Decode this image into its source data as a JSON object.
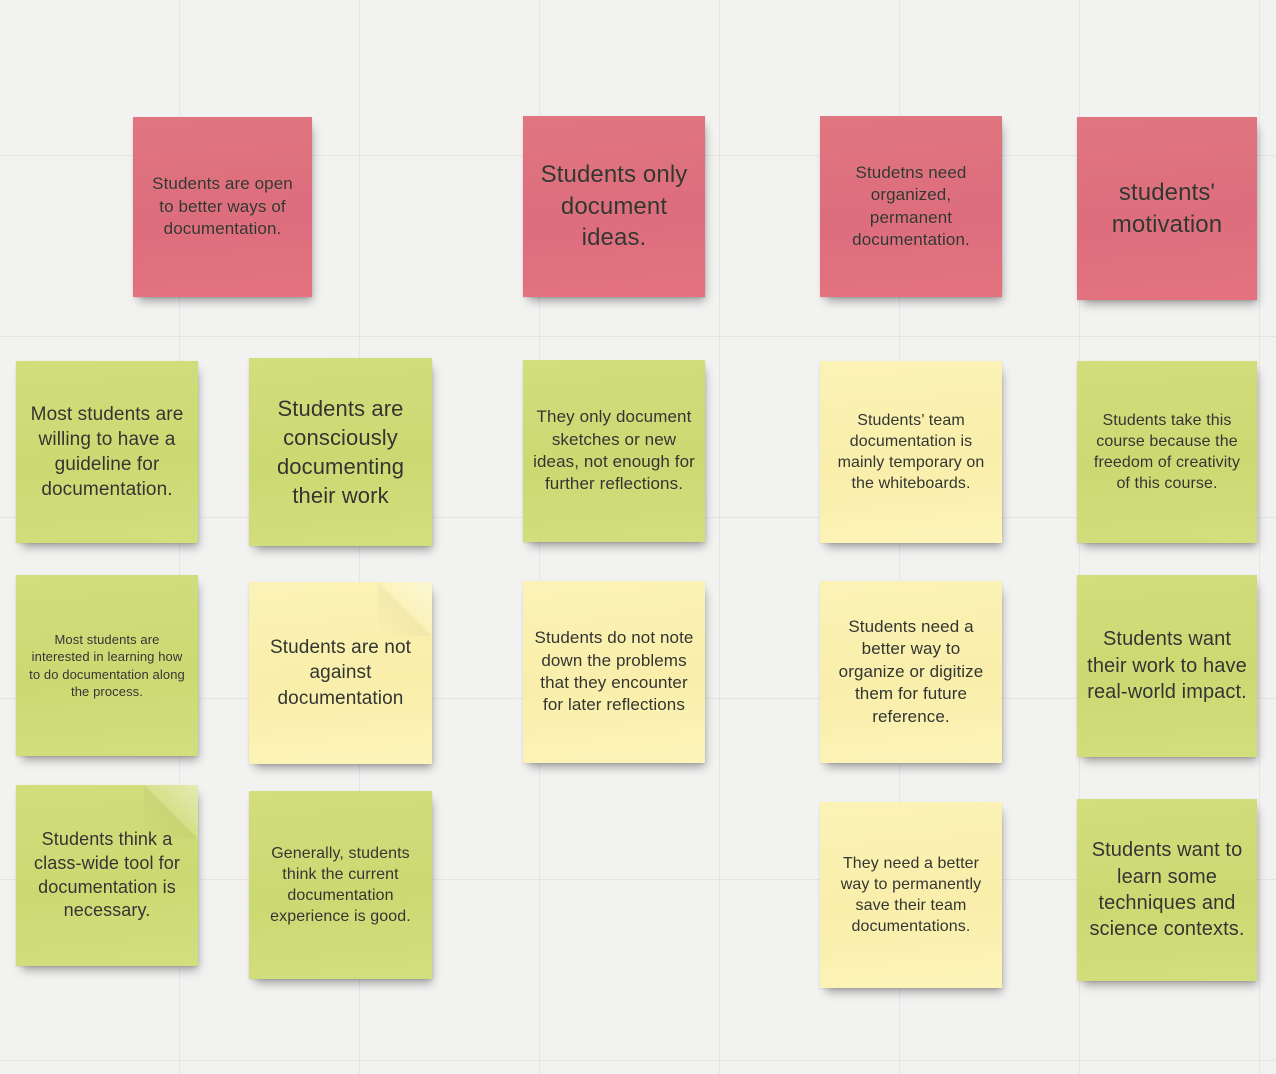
{
  "board": {
    "name": "sticky-note-board",
    "background_color": "#f2f2f1",
    "grid_color": "#e6e6e5",
    "grid_size_px": 180
  },
  "colors": {
    "pink": "#de707e",
    "green": "#cedb76",
    "yellow": "#faf0ae",
    "text": "#33352f"
  },
  "notes": [
    {
      "id": "note-r1c1",
      "color": "pink",
      "font_px": 17,
      "text": "Students are open to better ways of documentation."
    },
    {
      "id": "note-r1c3",
      "color": "pink",
      "font_px": 24,
      "text": "Students only document ideas."
    },
    {
      "id": "note-r1c4",
      "color": "pink",
      "font_px": 17,
      "text": "Studetns need organized, permanent documentation."
    },
    {
      "id": "note-r1c5",
      "color": "pink",
      "font_px": 24,
      "text": "students' motivation"
    },
    {
      "id": "note-r2c1",
      "color": "green",
      "font_px": 19,
      "text": "Most students are willing to have a guideline for documentation."
    },
    {
      "id": "note-r2c2",
      "color": "green",
      "font_px": 22,
      "text": "Students are consciously documenting their work"
    },
    {
      "id": "note-r2c3",
      "color": "green",
      "font_px": 17,
      "text": "They only document sketches or new ideas, not enough for further reflections."
    },
    {
      "id": "note-r2c4",
      "color": "yellow",
      "font_px": 16,
      "text": "Students’ team documentation is mainly temporary on the whiteboards."
    },
    {
      "id": "note-r2c5",
      "color": "green",
      "font_px": 16,
      "text": "Students take this course because the freedom of creativity of this course."
    },
    {
      "id": "note-r3c1",
      "color": "green",
      "font_px": 13,
      "text": "Most students are interested in learning how to do documentation along the  process."
    },
    {
      "id": "note-r3c2",
      "color": "yellow",
      "font_px": 19,
      "creased": true,
      "text": "Students are not against documentation"
    },
    {
      "id": "note-r3c3",
      "color": "yellow",
      "font_px": 17,
      "text": "Students do not note down the problems that they encounter for later reflections"
    },
    {
      "id": "note-r3c4",
      "color": "yellow",
      "font_px": 17,
      "text": "Students need a better way to organize or digitize them for future reference."
    },
    {
      "id": "note-r3c5",
      "color": "green",
      "font_px": 20,
      "text": "Students want their work to have real-world impact."
    },
    {
      "id": "note-r4c1",
      "color": "green",
      "font_px": 18,
      "creased": true,
      "text": "Students think a class-wide tool for documentation is necessary."
    },
    {
      "id": "note-r4c2",
      "color": "green",
      "font_px": 16,
      "text": "Generally, students think the current documentation experience is good."
    },
    {
      "id": "note-r4c4",
      "color": "yellow",
      "font_px": 16,
      "text": "They need a better way to permanently save their team documentations."
    },
    {
      "id": "note-r4c5",
      "color": "green",
      "font_px": 20,
      "text": "Students want to learn some techniques and science contexts."
    }
  ]
}
